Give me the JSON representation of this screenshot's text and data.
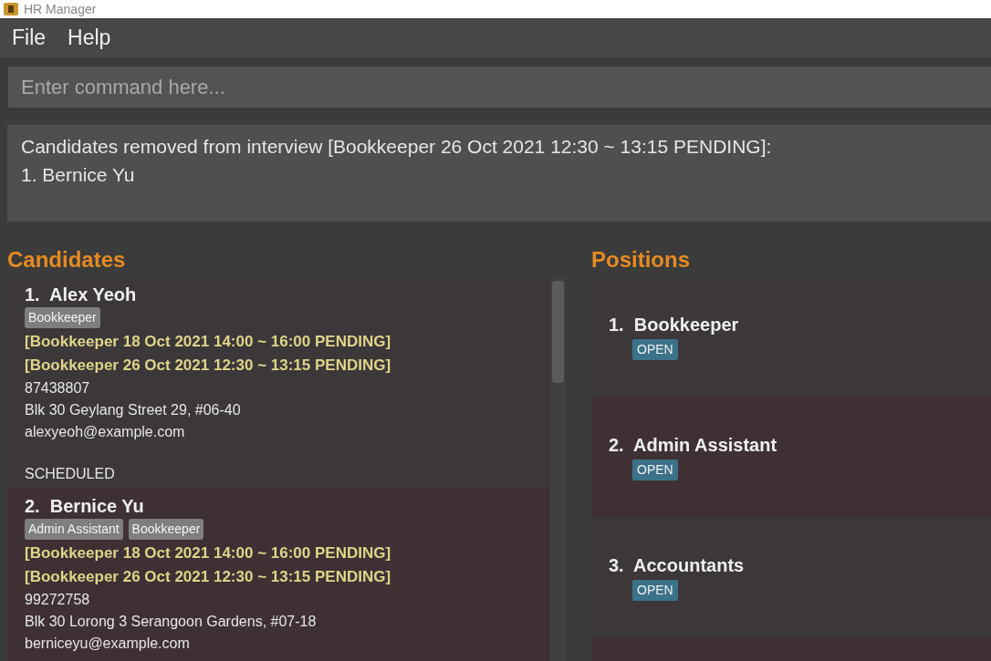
{
  "window": {
    "title": "HR Manager"
  },
  "menu": [
    "File",
    "Help"
  ],
  "command": {
    "placeholder": "Enter command here..."
  },
  "result": {
    "lines": [
      "Candidates removed from interview [Bookkeeper 26 Oct 2021 12:30 ~ 13:15 PENDING]:",
      "1. Bernice Yu"
    ]
  },
  "candidates": {
    "heading": "Candidates",
    "items": [
      {
        "index": "1.",
        "name": "Alex Yeoh",
        "tags": [
          "Bookkeeper"
        ],
        "interviews": [
          "[Bookkeeper 18 Oct 2021 14:00 ~ 16:00 PENDING]",
          "[Bookkeeper 26 Oct 2021 12:30 ~ 13:15 PENDING]"
        ],
        "phone": "87438807",
        "address": "Blk 30 Geylang Street 29, #06-40",
        "email": "alexyeoh@example.com",
        "status": "SCHEDULED"
      },
      {
        "index": "2.",
        "name": "Bernice Yu",
        "tags": [
          "Admin Assistant",
          "Bookkeeper"
        ],
        "interviews": [
          "[Bookkeeper 18 Oct 2021 14:00 ~ 16:00 PENDING]",
          "[Bookkeeper 26 Oct 2021 12:30 ~ 13:15 PENDING]"
        ],
        "phone": "99272758",
        "address": "Blk 30 Lorong 3 Serangoon Gardens, #07-18",
        "email": "berniceyu@example.com"
      }
    ]
  },
  "positions": {
    "heading": "Positions",
    "items": [
      {
        "index": "1.",
        "title": "Bookkeeper",
        "status": "OPEN"
      },
      {
        "index": "2.",
        "title": "Admin Assistant",
        "status": "OPEN"
      },
      {
        "index": "3.",
        "title": "Accountants",
        "status": "OPEN"
      }
    ]
  }
}
